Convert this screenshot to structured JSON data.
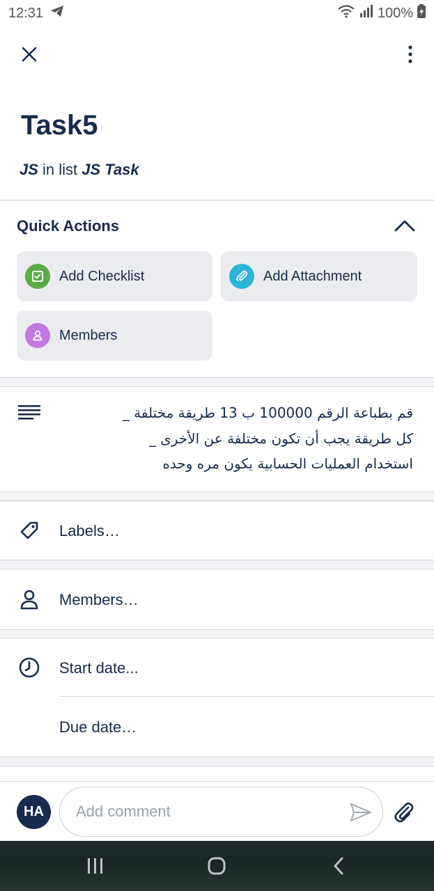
{
  "status_bar": {
    "time": "12:31",
    "battery": "100%"
  },
  "card": {
    "title": "Task5",
    "board": "JS",
    "list_prefix": "in list",
    "list": "JS Task"
  },
  "quick_actions": {
    "header": "Quick Actions",
    "add_checklist": "Add Checklist",
    "add_attachment": "Add Attachment",
    "members": "Members",
    "colors": {
      "checklist": "#5aac44",
      "attachment": "#29b6d8",
      "members": "#c377e0"
    }
  },
  "description": {
    "lines": [
      "قم بطباعة الرقم 100000 ب 13 طريقة مختلفة _",
      "كل طريقة يجب أن تكون مختلفة عن الأخرى _",
      "استخدام العمليات الحسابية يكون مره وحده"
    ]
  },
  "fields": {
    "labels": "Labels…",
    "members": "Members…",
    "start_date": "Start date...",
    "due_date": "Due date…"
  },
  "comment": {
    "avatar_initials": "HA",
    "placeholder": "Add comment"
  },
  "colors": {
    "text": "#172b4d",
    "avatar_bg": "#172b4d",
    "button_bg": "#ebecf0"
  }
}
